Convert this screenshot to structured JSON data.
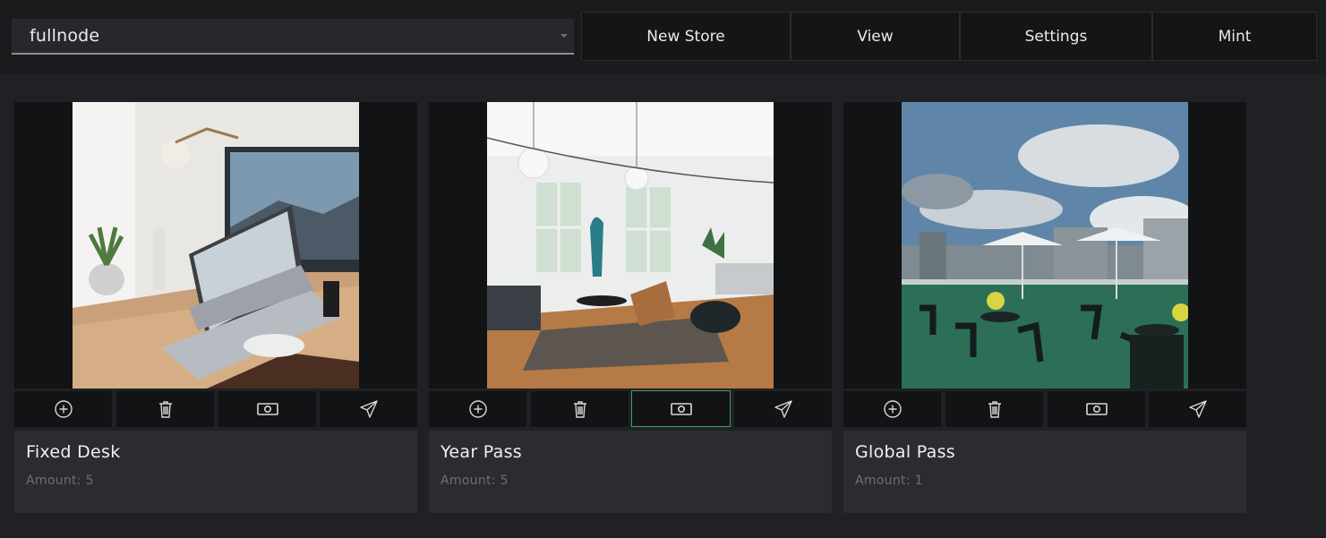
{
  "node_selector": {
    "value": "fullnode"
  },
  "nav": {
    "new_store": "New Store",
    "view": "View",
    "settings": "Settings",
    "mint": "Mint"
  },
  "cards": [
    {
      "name": "Fixed Desk",
      "amount": "Amount: 5",
      "photo": "laptop-desk-photo"
    },
    {
      "name": "Year Pass",
      "amount": "Amount: 5",
      "photo": "lounge-room-photo"
    },
    {
      "name": "Global Pass",
      "amount": "Amount: 1",
      "photo": "rooftop-terrace-photo"
    }
  ],
  "card_actions": [
    "plus-circle-icon",
    "trash-icon",
    "banknote-icon",
    "send-icon"
  ],
  "colors": {
    "background": "#1f2124",
    "topbar": "#1a1b1d",
    "nav_button": "#141516",
    "card_info": "#2a2c2f",
    "active_outline": "#3ea35a"
  }
}
